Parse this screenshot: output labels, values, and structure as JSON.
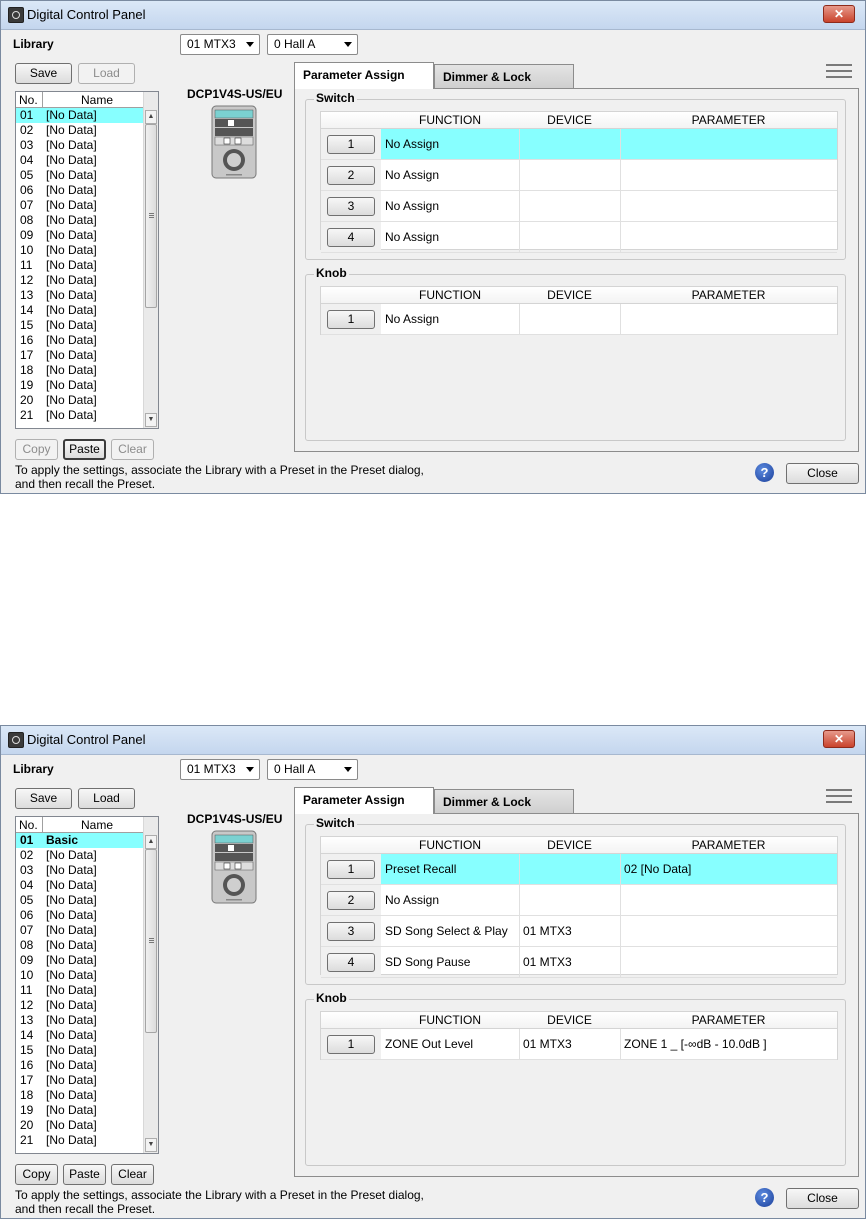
{
  "windows": [
    {
      "title": "Digital Control Panel",
      "library_label": "Library",
      "device_combo": "01 MTX3",
      "preset_combo": "0 Hall A",
      "buttons": {
        "save": "Save",
        "load": "Load",
        "copy": "Copy",
        "paste": "Paste",
        "clear": "Clear",
        "close": "Close"
      },
      "list_header": {
        "no": "No.",
        "name": "Name"
      },
      "library_items": [
        {
          "no": "01",
          "name": "[No Data]"
        },
        {
          "no": "02",
          "name": "[No Data]"
        },
        {
          "no": "03",
          "name": "[No Data]"
        },
        {
          "no": "04",
          "name": "[No Data]"
        },
        {
          "no": "05",
          "name": "[No Data]"
        },
        {
          "no": "06",
          "name": "[No Data]"
        },
        {
          "no": "07",
          "name": "[No Data]"
        },
        {
          "no": "08",
          "name": "[No Data]"
        },
        {
          "no": "09",
          "name": "[No Data]"
        },
        {
          "no": "10",
          "name": "[No Data]"
        },
        {
          "no": "11",
          "name": "[No Data]"
        },
        {
          "no": "12",
          "name": "[No Data]"
        },
        {
          "no": "13",
          "name": "[No Data]"
        },
        {
          "no": "14",
          "name": "[No Data]"
        },
        {
          "no": "15",
          "name": "[No Data]"
        },
        {
          "no": "16",
          "name": "[No Data]"
        },
        {
          "no": "17",
          "name": "[No Data]"
        },
        {
          "no": "18",
          "name": "[No Data]"
        },
        {
          "no": "19",
          "name": "[No Data]"
        },
        {
          "no": "20",
          "name": "[No Data]"
        },
        {
          "no": "21",
          "name": "[No Data]"
        }
      ],
      "device_model": "DCP1V4S-US/EU",
      "tabs": [
        "Parameter Assign",
        "Dimmer & Lock"
      ],
      "switch_group": "Switch",
      "knob_group": "Knob",
      "columns": [
        "FUNCTION",
        "DEVICE",
        "PARAMETER"
      ],
      "switch_rows": [
        {
          "num": "1",
          "function": "No Assign",
          "device": "",
          "parameter": ""
        },
        {
          "num": "2",
          "function": "No Assign",
          "device": "",
          "parameter": ""
        },
        {
          "num": "3",
          "function": "No Assign",
          "device": "",
          "parameter": ""
        },
        {
          "num": "4",
          "function": "No Assign",
          "device": "",
          "parameter": ""
        }
      ],
      "knob_rows": [
        {
          "num": "1",
          "function": "No Assign",
          "device": "",
          "parameter": ""
        }
      ],
      "note_line1": "To apply the settings, associate the Library with a Preset in the Preset dialog,",
      "note_line2": "and then recall the Preset.",
      "help": "?"
    },
    {
      "title": "Digital Control Panel",
      "library_label": "Library",
      "device_combo": "01 MTX3",
      "preset_combo": "0 Hall A",
      "buttons": {
        "save": "Save",
        "load": "Load",
        "copy": "Copy",
        "paste": "Paste",
        "clear": "Clear",
        "close": "Close"
      },
      "list_header": {
        "no": "No.",
        "name": "Name"
      },
      "library_items": [
        {
          "no": "01",
          "name": "Basic"
        },
        {
          "no": "02",
          "name": "[No Data]"
        },
        {
          "no": "03",
          "name": "[No Data]"
        },
        {
          "no": "04",
          "name": "[No Data]"
        },
        {
          "no": "05",
          "name": "[No Data]"
        },
        {
          "no": "06",
          "name": "[No Data]"
        },
        {
          "no": "07",
          "name": "[No Data]"
        },
        {
          "no": "08",
          "name": "[No Data]"
        },
        {
          "no": "09",
          "name": "[No Data]"
        },
        {
          "no": "10",
          "name": "[No Data]"
        },
        {
          "no": "11",
          "name": "[No Data]"
        },
        {
          "no": "12",
          "name": "[No Data]"
        },
        {
          "no": "13",
          "name": "[No Data]"
        },
        {
          "no": "14",
          "name": "[No Data]"
        },
        {
          "no": "15",
          "name": "[No Data]"
        },
        {
          "no": "16",
          "name": "[No Data]"
        },
        {
          "no": "17",
          "name": "[No Data]"
        },
        {
          "no": "18",
          "name": "[No Data]"
        },
        {
          "no": "19",
          "name": "[No Data]"
        },
        {
          "no": "20",
          "name": "[No Data]"
        },
        {
          "no": "21",
          "name": "[No Data]"
        }
      ],
      "device_model": "DCP1V4S-US/EU",
      "tabs": [
        "Parameter Assign",
        "Dimmer & Lock"
      ],
      "switch_group": "Switch",
      "knob_group": "Knob",
      "columns": [
        "FUNCTION",
        "DEVICE",
        "PARAMETER"
      ],
      "switch_rows": [
        {
          "num": "1",
          "function": "Preset Recall",
          "device": "",
          "parameter": "02 [No Data]"
        },
        {
          "num": "2",
          "function": "No Assign",
          "device": "",
          "parameter": ""
        },
        {
          "num": "3",
          "function": "SD Song Select & Play",
          "device": "01 MTX3",
          "parameter": ""
        },
        {
          "num": "4",
          "function": "SD Song Pause",
          "device": "01 MTX3",
          "parameter": ""
        }
      ],
      "knob_rows": [
        {
          "num": "1",
          "function": "ZONE Out Level",
          "device": "01 MTX3",
          "parameter": "ZONE 1 _ [-∞dB - 10.0dB ]"
        }
      ],
      "note_line1": "To apply the settings, associate the Library with a Preset in the Preset dialog,",
      "note_line2": "and then recall the Preset.",
      "help": "?"
    }
  ]
}
